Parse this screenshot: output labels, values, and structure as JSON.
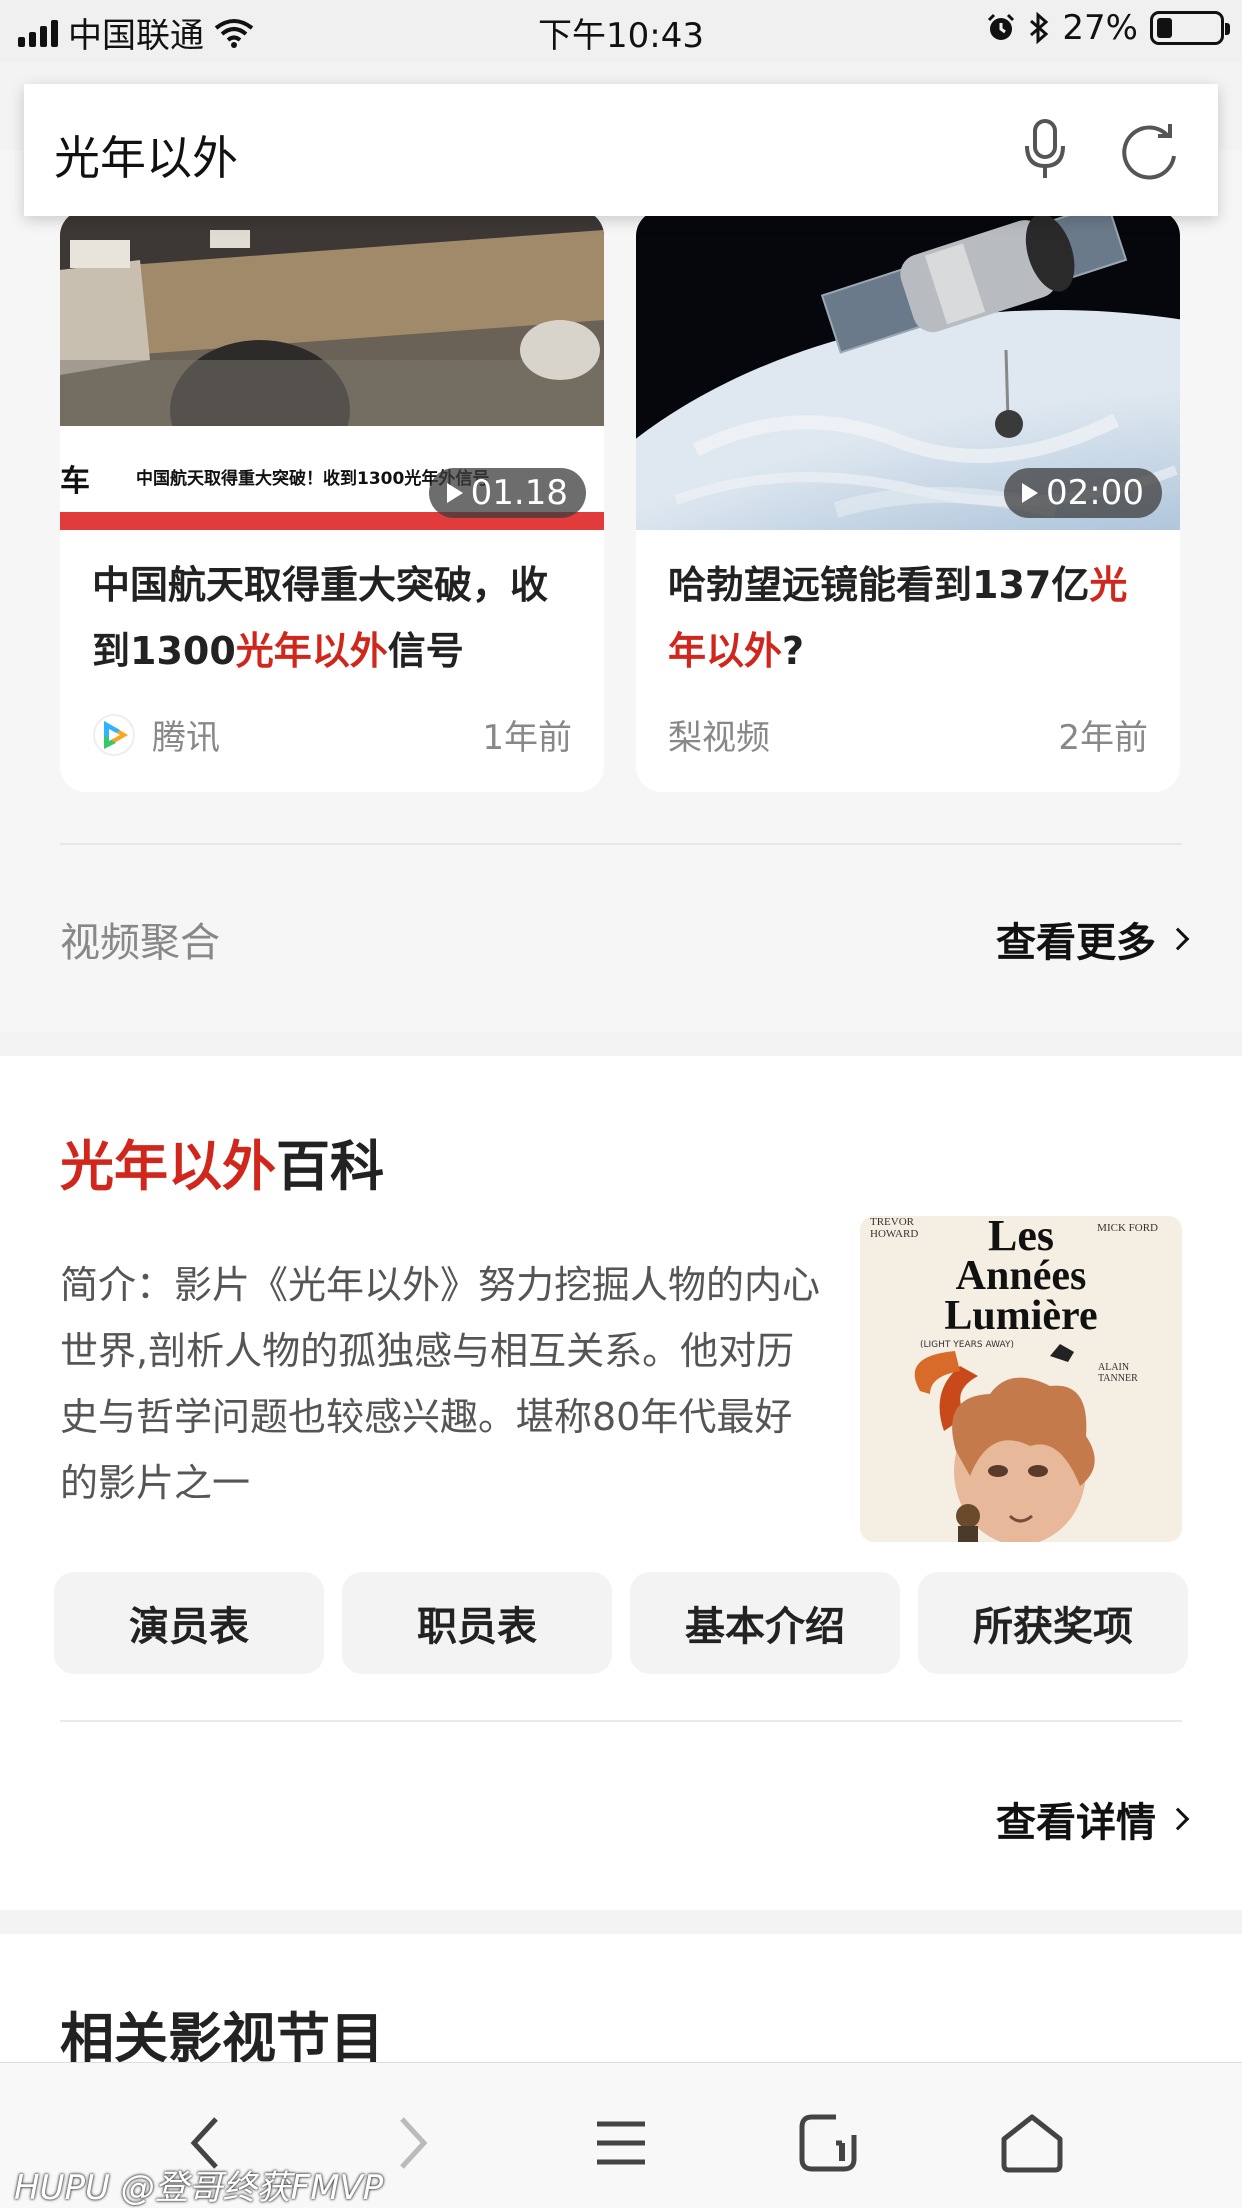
{
  "status_bar": {
    "carrier": "中国联通",
    "time": "下午10:43",
    "battery": "27%",
    "battery_level": 0.27
  },
  "search": {
    "query": "光年以外",
    "mic_icon": "microphone-icon",
    "refresh_icon": "refresh-icon"
  },
  "videos": {
    "items": [
      {
        "duration": "01.18",
        "title_pre": "中国航天取得重大突破，收到1300",
        "title_hl": "光年以外",
        "title_post": "信号",
        "source": "腾讯",
        "time": "1年前",
        "thumb_caption": "中国航天取得重大突破！收到1300光年外信号",
        "thumb_side": "车"
      },
      {
        "duration": "02:00",
        "title_pre": "哈勃望远镜能看到137亿",
        "title_hl": "光年以外",
        "title_post": "?",
        "source": "梨视频",
        "time": "2年前"
      }
    ],
    "footer_label": "视频聚合",
    "more_label": "查看更多"
  },
  "baike": {
    "heading_hl": "光年以外",
    "heading_rest": "百科",
    "description": "简介：影片《光年以外》努力挖掘人物的内心世界,剖析人物的孤独感与相互关系。他对历史与哲学问题也较感兴趣。堪称80年代最好的影片之一",
    "poster": {
      "top_left": "TREVOR HOWARD",
      "top_right": "MICK FORD",
      "title_line1": "Les",
      "title_line2": "Années",
      "title_line3": "Lumière",
      "subtitle": "(LIGHT YEARS AWAY)",
      "director": "ALAIN TANNER"
    },
    "buttons": [
      "演员表",
      "职员表",
      "基本介绍",
      "所获奖项"
    ],
    "detail_label": "查看详情"
  },
  "related": {
    "heading": "相关影视节目"
  },
  "watermark": "HUPU @登哥终获FMVP",
  "colors": {
    "accent": "#d0261b",
    "background": "#f3f3f3"
  }
}
